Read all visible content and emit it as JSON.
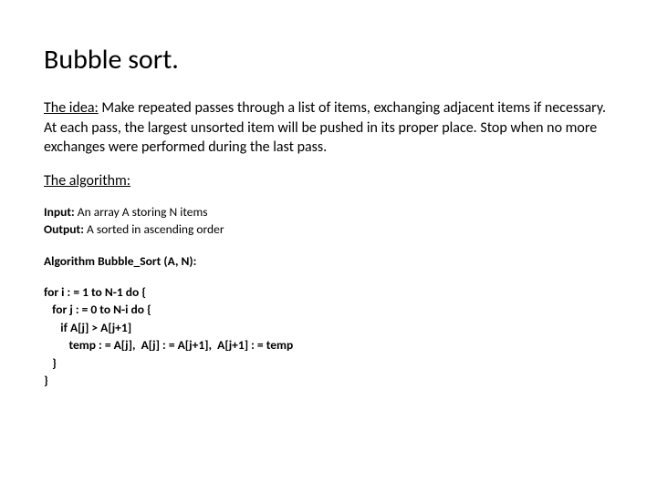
{
  "title": "Bubble sort.",
  "idea_label": "The idea:",
  "idea_text": " Make repeated passes through a list of items, exchanging adjacent items if necessary. At each pass, the largest unsorted item will be pushed in its proper place.  Stop when no more exchanges were performed during the last pass.",
  "algo_label": "The algorithm:",
  "io": {
    "input_label": "Input:",
    "input_text": " An array A storing N items",
    "output_label": "Output:",
    "output_text": " A sorted in ascending order"
  },
  "algoname": "Algorithm Bubble_Sort (A, N):",
  "code": "for i : = 1 to N-1 do {\n   for j : = 0 to N-i do {\n      if A[j] > A[j+1]\n         temp : = A[j],  A[j] : = A[j+1],  A[j+1] : = temp\n   }\n}"
}
